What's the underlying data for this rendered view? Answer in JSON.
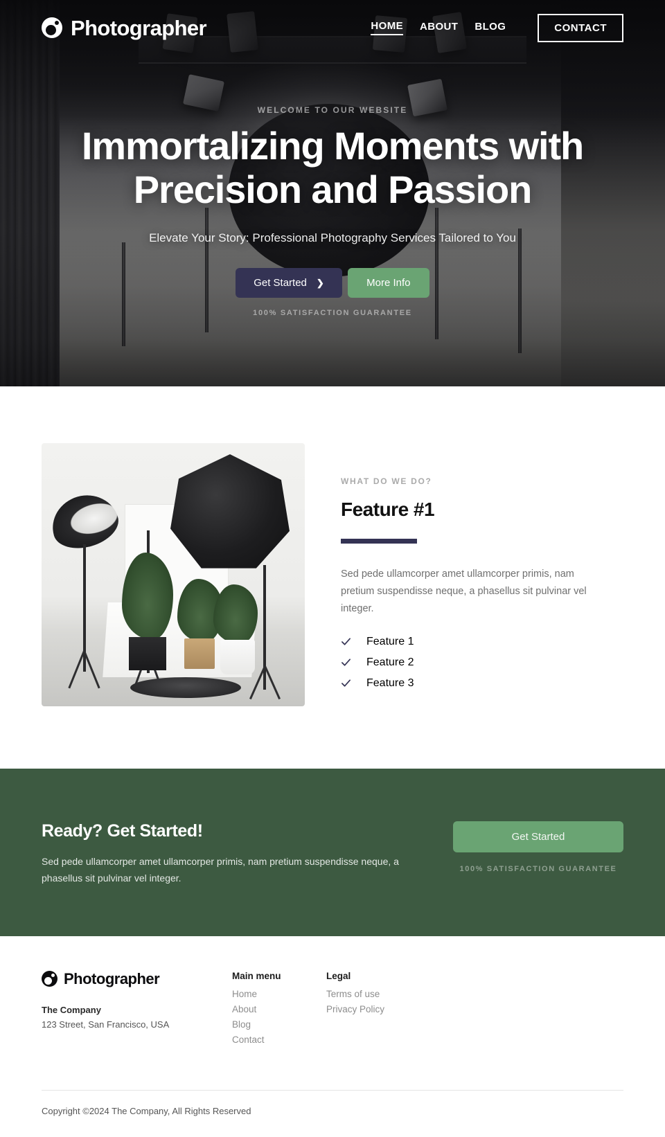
{
  "nav": {
    "brand": "Photographer",
    "brand_icon": "camera-lens-icon",
    "links": [
      {
        "label": "HOME",
        "active": true
      },
      {
        "label": "ABOUT",
        "active": false
      },
      {
        "label": "BLOG",
        "active": false
      }
    ],
    "cta_label": "CONTACT"
  },
  "hero": {
    "eyebrow": "WELCOME TO OUR WEBSITE",
    "title": "Immortalizing Moments with Precision and Passion",
    "subtitle": "Elevate Your Story: Professional Photography Services Tailored to You",
    "primary_button": "Get Started",
    "primary_button_icon": "chevron-right-icon",
    "secondary_button": "More Info",
    "guarantee": "100% SATISFACTION GUARANTEE"
  },
  "feature": {
    "image_alt": "photography-studio-image",
    "eyebrow": "WHAT DO WE DO?",
    "title": "Feature #1",
    "body": "Sed pede ullamcorper amet ullamcorper primis, nam pretium suspendisse neque, a phasellus sit pulvinar vel integer.",
    "items": [
      {
        "label": "Feature 1"
      },
      {
        "label": "Feature 2"
      },
      {
        "label": "Feature 3"
      }
    ]
  },
  "cta": {
    "title": "Ready? Get Started!",
    "body": "Sed pede ullamcorper amet ullamcorper primis, nam pretium suspendisse neque, a phasellus sit pulvinar vel integer.",
    "button_label": "Get Started",
    "guarantee": "100% SATISFACTION GUARANTEE"
  },
  "footer": {
    "brand": "Photographer",
    "company": "The Company",
    "address": "123 Street, San Francisco, USA",
    "columns": [
      {
        "title": "Main menu",
        "links": [
          {
            "label": "Home"
          },
          {
            "label": "About"
          },
          {
            "label": "Blog"
          },
          {
            "label": "Contact"
          }
        ]
      },
      {
        "title": "Legal",
        "links": [
          {
            "label": "Terms of use"
          },
          {
            "label": "Privacy Policy"
          }
        ]
      }
    ],
    "copyright": "Copyright ©2024 The Company, All Rights Reserved"
  },
  "colors": {
    "accent_navy": "#343354",
    "accent_green": "#6aa473",
    "cta_background": "#3d5a41"
  }
}
